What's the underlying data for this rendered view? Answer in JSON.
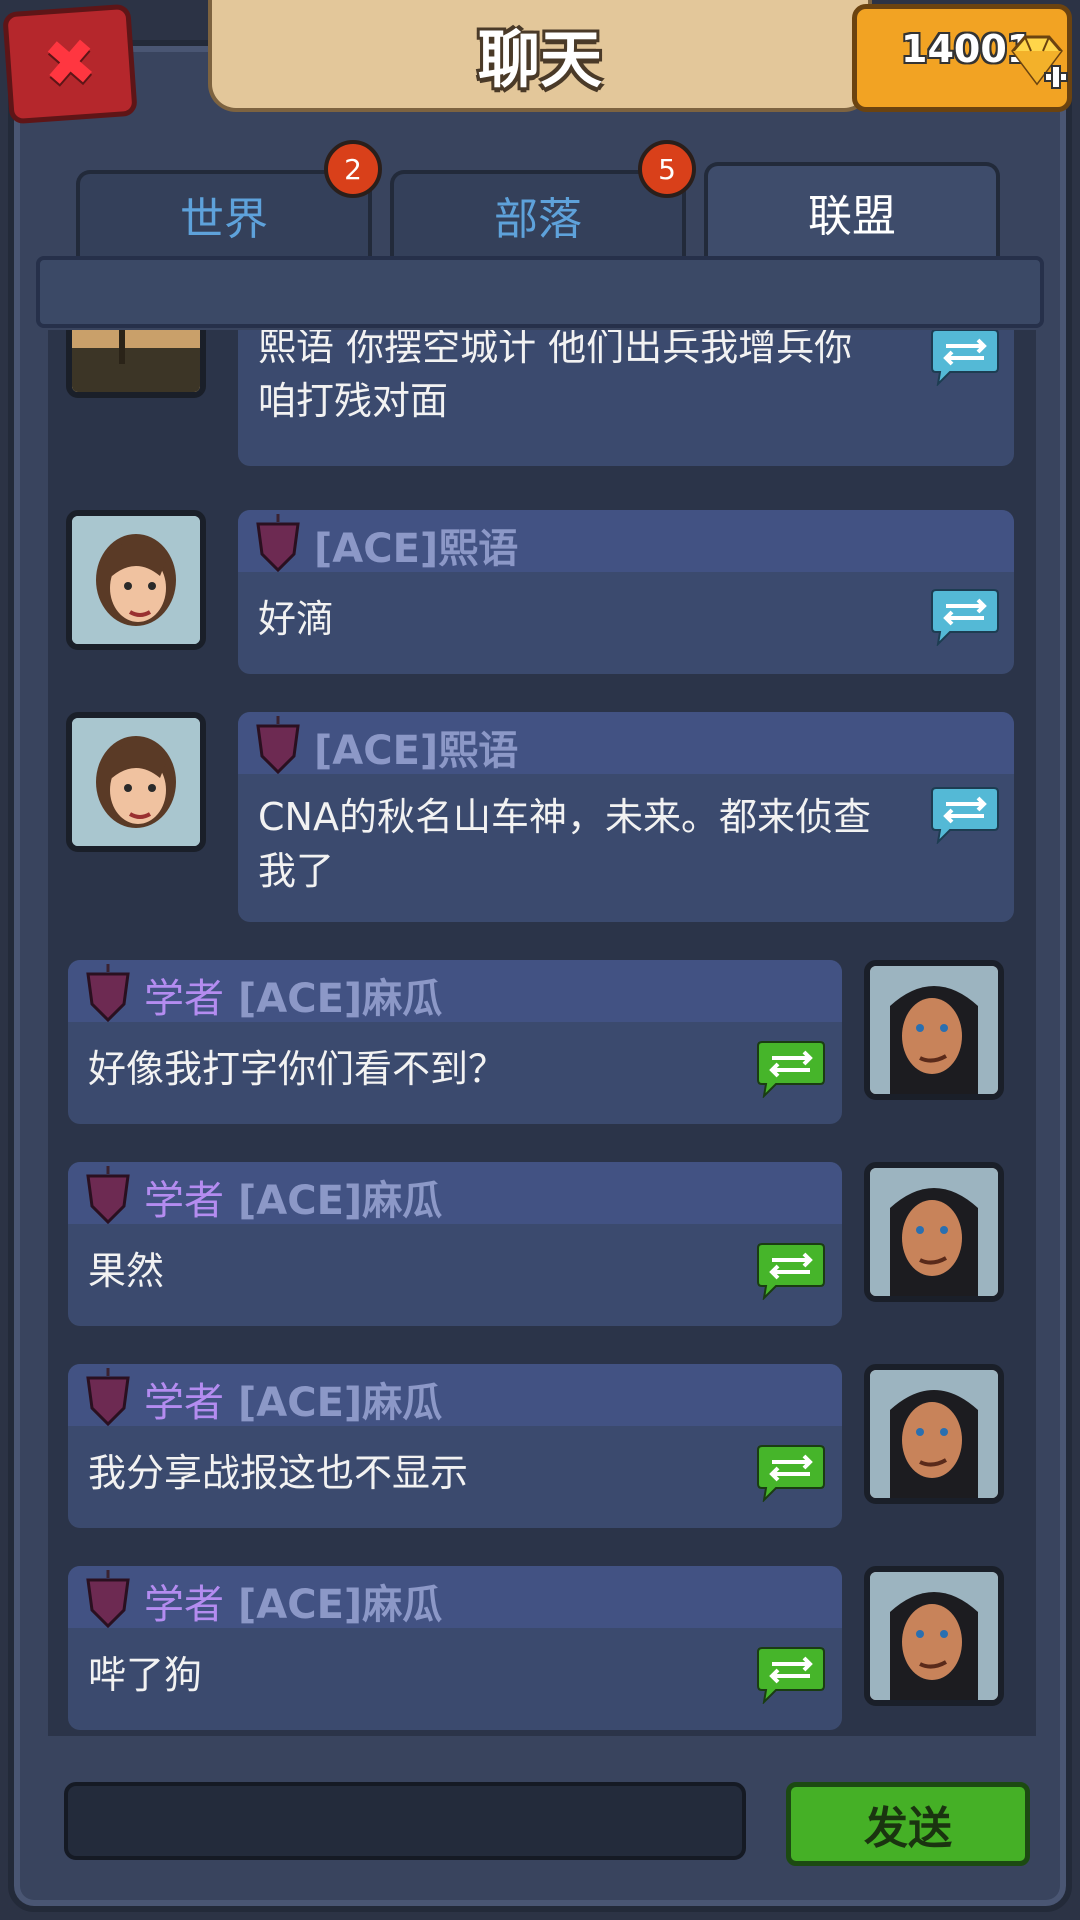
{
  "header": {
    "title": "聊天",
    "close_icon": "close-x-icon",
    "gems": "14001",
    "gem_icon": "diamond-plus-icon"
  },
  "tabs": [
    {
      "label": "世界",
      "badge": "2"
    },
    {
      "label": "部落",
      "badge": "5"
    },
    {
      "label": "联盟",
      "badge": "",
      "active": true
    }
  ],
  "messages": [
    {
      "side": "left",
      "sender": "",
      "text_lines": [
        "熙语  你摆空城计  他们出兵我增兵你",
        "咱打残对面"
      ],
      "avatar": "landscape-avatar"
    },
    {
      "side": "left",
      "sender": "[ACE]熙语",
      "text_lines": [
        "好滴"
      ],
      "avatar": "woman-avatar"
    },
    {
      "side": "left",
      "sender": "[ACE]熙语",
      "text_lines": [
        "CNA的秋名山车神，未来。都来侦查",
        "我了"
      ],
      "avatar": "woman-avatar"
    },
    {
      "side": "right",
      "rank": "学者",
      "sender": "[ACE]麻瓜",
      "text_lines": [
        "好像我打字你们看不到？"
      ],
      "avatar": "man-avatar"
    },
    {
      "side": "right",
      "rank": "学者",
      "sender": "[ACE]麻瓜",
      "text_lines": [
        "果然"
      ],
      "avatar": "man-avatar"
    },
    {
      "side": "right",
      "rank": "学者",
      "sender": "[ACE]麻瓜",
      "text_lines": [
        "我分享战报这也不显示"
      ],
      "avatar": "man-avatar"
    },
    {
      "side": "right",
      "rank": "学者",
      "sender": "[ACE]麻瓜",
      "text_lines": [
        "哔了狗"
      ],
      "avatar": "man-avatar"
    }
  ],
  "footer": {
    "input_value": "",
    "send_label": "发送"
  },
  "colors": {
    "share_left": "#54b9d6",
    "share_right": "#46b52a",
    "rank_title": "#b48cf0",
    "sender_name": "#8c98c7"
  }
}
